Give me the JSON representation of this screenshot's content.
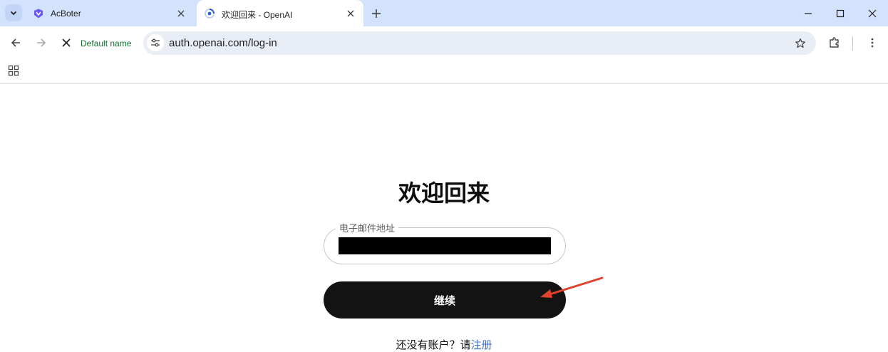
{
  "browser": {
    "tabs": [
      {
        "title": "AcBoter",
        "active": false,
        "favicon": "acboter-logo-icon"
      },
      {
        "title": "欢迎回来 - OpenAI",
        "active": true,
        "favicon": "loading-spinner-icon"
      }
    ],
    "profile_label": "Default name",
    "url": "auth.openai.com/log-in",
    "colors": {
      "tabstrip": "#d3e3fd",
      "omnibox": "#e9eef6",
      "profile_text": "#146c2e"
    }
  },
  "page": {
    "heading": "欢迎回来",
    "email": {
      "label": "电子邮件地址",
      "value": ""
    },
    "continue_label": "继续",
    "signup_prompt": "还没有账户？请",
    "signup_link": "注册",
    "colors": {
      "button": "#131313",
      "link": "#3b6fd6",
      "annotation_arrow": "#e0412c"
    }
  }
}
